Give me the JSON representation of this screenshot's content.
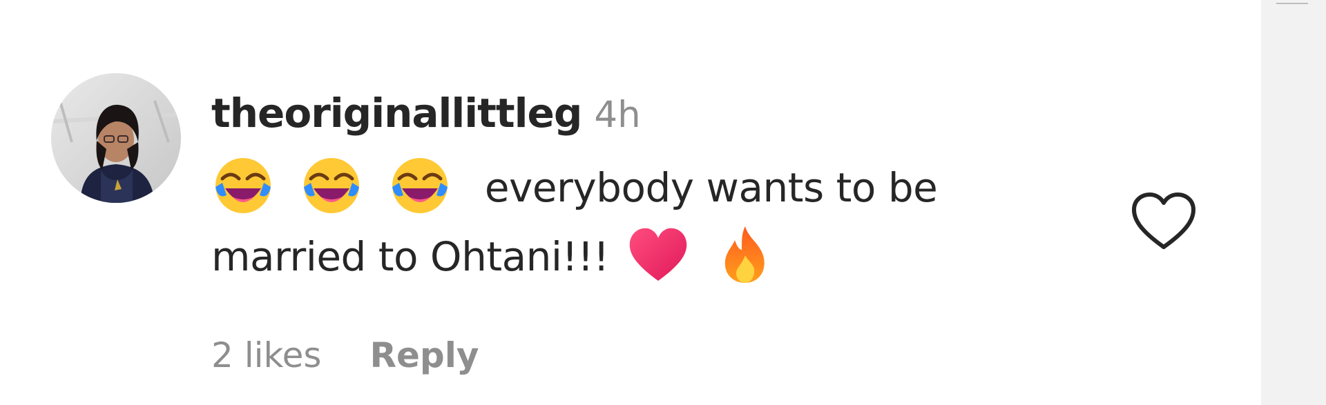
{
  "comment": {
    "username": "theoriginallittleg",
    "timestamp": "4h",
    "text_line1": "everybody wants to be",
    "text_line2": "married to Ohtani!!!",
    "emojis": {
      "laugh": "face-with-tears-of-joy",
      "heart": "heart",
      "fire": "fire"
    },
    "likes": "2 likes",
    "reply_label": "Reply"
  },
  "icons": {
    "like": "heart-outline-icon",
    "avatar": "user-profile-photo"
  },
  "colors": {
    "primary_text": "#262626",
    "secondary_text": "#8e8e8e",
    "heart_emoji": "#f0306d",
    "fire_emoji": "#ff7a1a"
  }
}
